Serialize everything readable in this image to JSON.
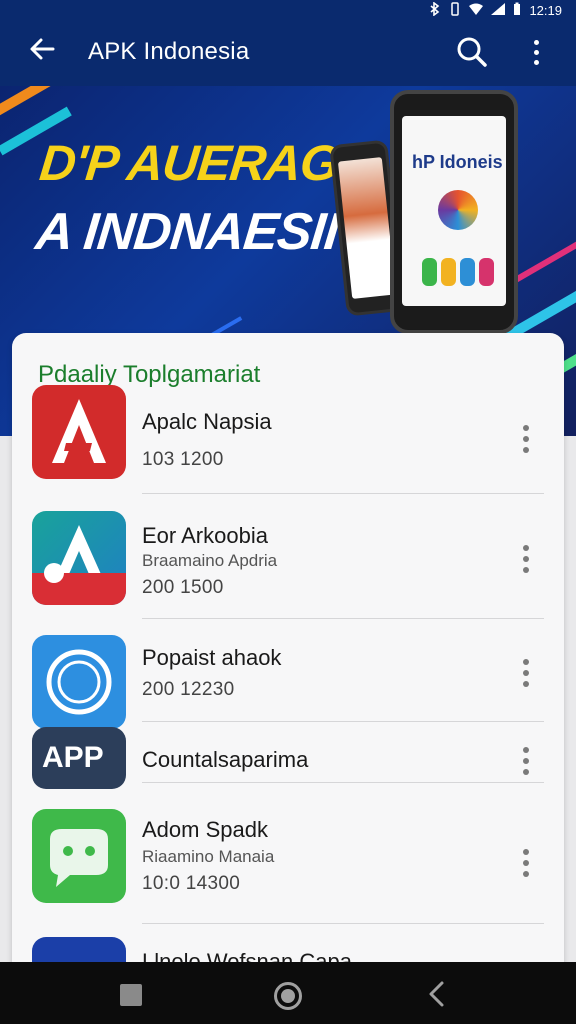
{
  "status_bar": {
    "time": "12:19",
    "icons": [
      "bluetooth-icon",
      "vibrate-icon",
      "wifi-icon",
      "signal-icon",
      "battery-icon"
    ]
  },
  "app_bar": {
    "title": "APK Indonesia",
    "back_icon": "arrow-left-icon",
    "search_icon": "search-icon",
    "more_icon": "more-vert-icon",
    "background": "#0a2a6e"
  },
  "banner": {
    "line1": "D'P AUERAGIA",
    "line2": "A INDNAESII",
    "phone_logo": "hP Idoneis"
  },
  "list": {
    "section_title": "Pdaaliy Toplgamariat",
    "items": [
      {
        "name": "Apalc Napsia",
        "subtitle": "",
        "stats": "103  1200",
        "icon": "app-icon-red-a"
      },
      {
        "name": "Eor Arkoobia",
        "subtitle": "Braamaino Apdria",
        "stats": "200  1500",
        "icon": "app-icon-teal-a"
      },
      {
        "name": "Popaist ahaok",
        "subtitle": "",
        "stats": "200  12230",
        "icon": "app-icon-blue-circle"
      },
      {
        "name": "Countalsaparima",
        "subtitle": "",
        "stats": "",
        "icon": "app-icon-app-badge",
        "icon_text": "APP"
      },
      {
        "name": "Adom Spadk",
        "subtitle": "Riaamino Manaia",
        "stats": "10:0  14300",
        "icon": "app-icon-green-android"
      },
      {
        "name": "Llnolo Wofsnan Capa",
        "subtitle": "",
        "stats": "",
        "icon": "app-icon-blue-partial"
      }
    ]
  },
  "colors": {
    "accent_green": "#1b7e2c",
    "banner_yellow": "#f6d21a"
  },
  "nav_bar": {
    "recent_icon": "recent-apps-icon",
    "home_icon": "home-icon",
    "back_icon": "back-triangle-icon"
  }
}
